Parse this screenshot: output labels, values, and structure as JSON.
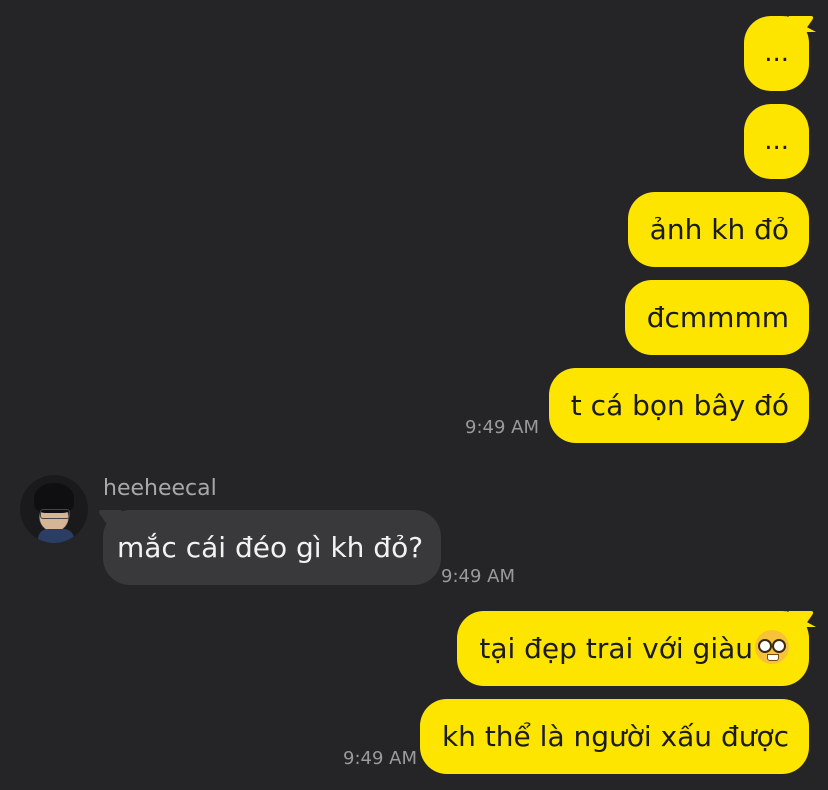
{
  "messages": [
    {
      "id": "m1",
      "text": "..."
    },
    {
      "id": "m2",
      "text": "..."
    },
    {
      "id": "m3",
      "text": "ảnh kh đỏ"
    },
    {
      "id": "m4",
      "text": "đcmmmm"
    },
    {
      "id": "m5",
      "text": "t cá bọn bây đó"
    },
    {
      "id": "m6",
      "sender": "heeheecal",
      "text": "mắc cái đéo gì kh đỏ?"
    },
    {
      "id": "m7",
      "text": "tại đẹp trai với giàu",
      "emoji": "nerd-face-emoji"
    },
    {
      "id": "m8",
      "text": "kh thể là người xấu được"
    }
  ],
  "times": {
    "t1": "9:49 AM",
    "t2": "9:49 AM",
    "t3": "9:49 AM"
  },
  "colors": {
    "background": "#252527",
    "sent_bubble": "#fee500",
    "received_bubble": "#39393b",
    "timestamp": "#9a9a9c"
  }
}
